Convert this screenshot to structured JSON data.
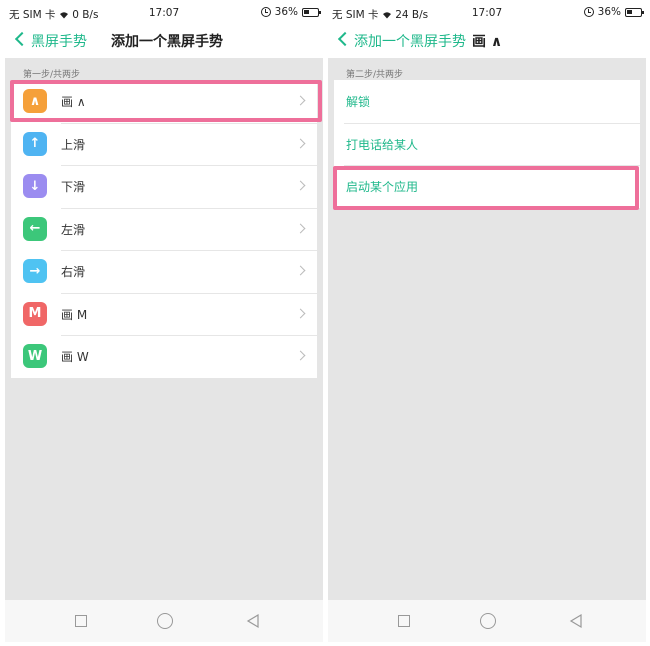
{
  "colors": {
    "accent": "#1fb88b",
    "highlight": "#ee6f9a"
  },
  "left_screen": {
    "status": {
      "left": "无 SIM 卡",
      "speed": "0 B/s",
      "time": "17:07",
      "battery": "36%"
    },
    "nav": {
      "back_label": "黑屏手势",
      "title": "添加一个黑屏手势"
    },
    "section_label": "第一步/共两步",
    "gestures": [
      {
        "label": "画 ∧",
        "icon_glyph": "∧",
        "color": "#f5a03a",
        "icon": "caret-up-icon"
      },
      {
        "label": "上滑",
        "icon_glyph": "↑",
        "color": "#4fb4f2",
        "icon": "arrow-up-icon"
      },
      {
        "label": "下滑",
        "icon_glyph": "↓",
        "color": "#9b8cf0",
        "icon": "arrow-down-icon"
      },
      {
        "label": "左滑",
        "icon_glyph": "←",
        "color": "#3cc77a",
        "icon": "arrow-left-icon"
      },
      {
        "label": "右滑",
        "icon_glyph": "→",
        "color": "#4fc3f2",
        "icon": "arrow-right-icon"
      },
      {
        "label": "画 M",
        "icon_glyph": "M",
        "color": "#f06767",
        "icon": "letter-m-icon"
      },
      {
        "label": "画 W",
        "icon_glyph": "W",
        "color": "#3cc77a",
        "icon": "letter-w-icon"
      }
    ],
    "highlighted_item": "画 ∧"
  },
  "right_screen": {
    "status": {
      "left": "无 SIM 卡",
      "speed": "24 B/s",
      "time": "17:07",
      "battery": "36%"
    },
    "nav": {
      "back_label": "添加一个黑屏手势",
      "title": "画 ∧"
    },
    "section_label": "第二步/共两步",
    "actions": [
      {
        "label": "解锁"
      },
      {
        "label": "打电话给某人"
      },
      {
        "label": "启动某个应用"
      }
    ],
    "highlighted_item": "启动某个应用"
  }
}
